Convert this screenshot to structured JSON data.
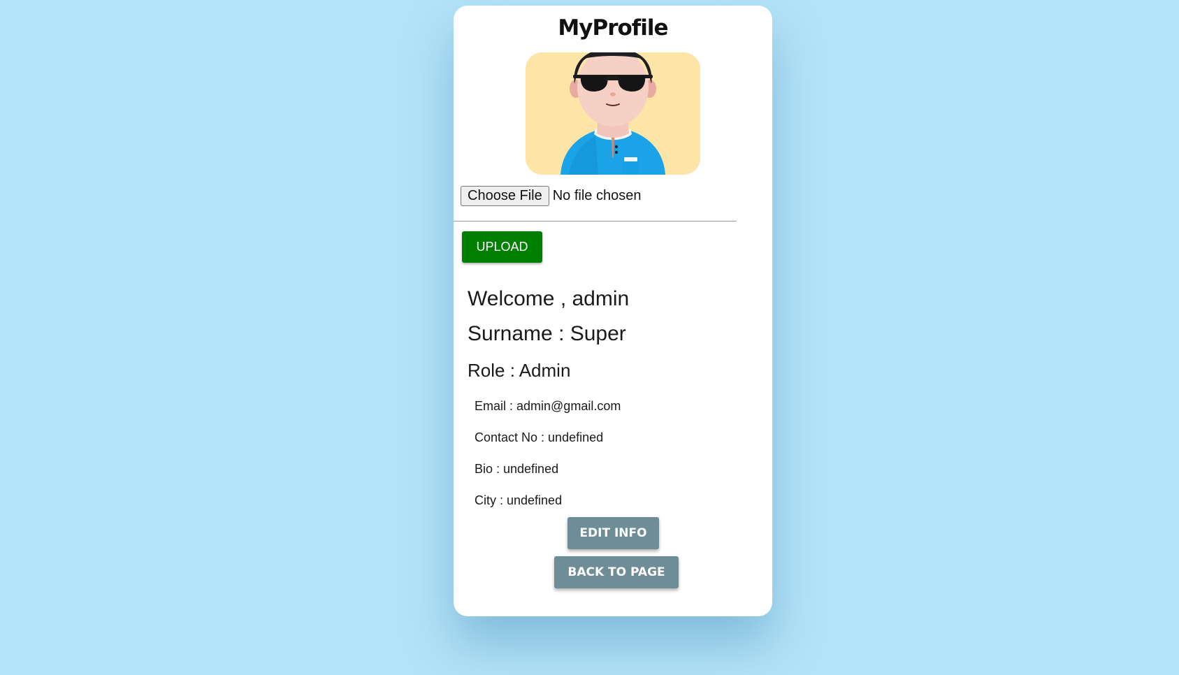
{
  "profile": {
    "title": "MyProfile",
    "avatar_icon": "user-avatar-3d-sunglasses"
  },
  "file_input": {
    "button_label": "Choose File",
    "status": "No file chosen"
  },
  "upload": {
    "label": "UPLOAD",
    "color": "#008000"
  },
  "details": {
    "welcome": "Welcome , admin",
    "surname": "Surname : Super",
    "role": "Role : Admin",
    "email": "Email : admin@gmail.com",
    "contact": "Contact No : undefined",
    "bio": "Bio : undefined",
    "city": "City : undefined"
  },
  "actions": {
    "edit_label": "EDIT INFO",
    "back_label": "BACK TO PAGE",
    "color": "#6f8d96"
  },
  "theme": {
    "background": "#b3e3f8",
    "card": "#ffffff"
  }
}
